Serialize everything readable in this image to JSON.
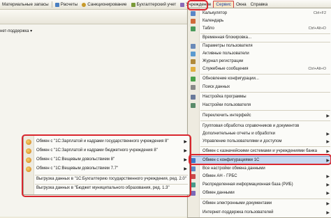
{
  "menubar": {
    "items": [
      {
        "label": "Материальные запасы",
        "icon": "none"
      },
      {
        "label": "Расчеты",
        "icon": "calc-icon"
      },
      {
        "label": "Санкционирование",
        "icon": "sanction-icon"
      },
      {
        "label": "Бухгалтерский учет",
        "icon": "ledger-icon"
      },
      {
        "label": "Учреждение",
        "icon": "institution-icon"
      },
      {
        "label": "Сервис",
        "icon": "none"
      },
      {
        "label": "Окна",
        "icon": "none"
      },
      {
        "label": "Справка",
        "icon": "none"
      }
    ]
  },
  "workarea": {
    "subbar_label": "нет-поддержка ▾"
  },
  "service_menu": {
    "items": [
      {
        "label": "Калькулятор",
        "shortcut": "Ctrl+F2",
        "icon": "calculator-icon"
      },
      {
        "label": "Календарь",
        "shortcut": "",
        "icon": "calendar-icon"
      },
      {
        "label": "Табло",
        "shortcut": "Ctrl+Alt+D",
        "icon": "board-icon"
      },
      {
        "label": "Временная блокировка...",
        "shortcut": "",
        "icon": "lock-icon"
      },
      {
        "label": "Параметры пользователя",
        "shortcut": "",
        "icon": "user-params-icon"
      },
      {
        "label": "Активные пользователи",
        "shortcut": "",
        "icon": "active-users-icon"
      },
      {
        "label": "Журнал регистрации",
        "shortcut": "",
        "icon": "log-icon"
      },
      {
        "label": "Служебные сообщения",
        "shortcut": "Ctrl+Alt+O",
        "icon": "messages-icon"
      },
      {
        "label": "Обновление конфигурации...",
        "shortcut": "",
        "icon": "update-icon"
      },
      {
        "label": "Поиск данных",
        "shortcut": "",
        "icon": "search-icon"
      },
      {
        "label": "Настройка программы",
        "shortcut": "",
        "icon": "program-settings-icon"
      },
      {
        "label": "Настройки пользователя",
        "shortcut": "",
        "icon": "user-settings-icon"
      },
      {
        "label": "Переключить интерфейс",
        "shortcut": "",
        "icon": "none"
      },
      {
        "label": "Групповая обработка справочников и документов",
        "shortcut": "",
        "icon": "none"
      },
      {
        "label": "Дополнительные отчеты и обработки",
        "shortcut": "",
        "icon": "none"
      },
      {
        "label": "Управление пользователями и доступом",
        "shortcut": "",
        "icon": "none"
      },
      {
        "label": "Обмен с казначейскими системами и учреждениями банка",
        "shortcut": "",
        "icon": "none"
      },
      {
        "label": "Обмен с конфигурациями 1С",
        "shortcut": "",
        "icon": "exchange-icon"
      },
      {
        "label": "Все настройки обмена данными",
        "shortcut": "",
        "icon": "exchange-settings-icon"
      },
      {
        "label": "Обмен АН - ГРБС",
        "shortcut": "",
        "icon": "exchange-an-icon"
      },
      {
        "label": "Распределенная информационная база (РИБ)",
        "shortcut": "",
        "icon": "rib-icon"
      },
      {
        "label": "Обмен данными",
        "shortcut": "",
        "icon": "data-exchange-icon"
      },
      {
        "label": "Обмен электронными документами",
        "shortcut": "",
        "icon": "edoc-icon"
      },
      {
        "label": "Интернет-поддержка пользователей",
        "shortcut": "",
        "icon": "support-icon"
      }
    ]
  },
  "exchange_submenu": {
    "items": [
      {
        "label": "Обмен с \"1С:Зарплатой и кадрами государственного учреждения 8\"",
        "icon": "1c-icon"
      },
      {
        "label": "Обмен с \"1С:Зарплатой и кадрами бюджетного учреждения 8\"",
        "icon": "1c-icon"
      },
      {
        "label": "Обмен с \"1С:Вещевым довольствием 8\"",
        "icon": "1c-icon"
      },
      {
        "label": "Обмен с \"1С:Вещевым довольствием 7.7\"",
        "icon": "1c-icon"
      },
      {
        "label": "Выгрузка данных в \"1С:Бухгалтерию государственного учреждения, ред. 2.0\"",
        "icon": "none"
      },
      {
        "label": "Выгрузка данных в \"Бюджет муниципального образования, ред. 1.3\"",
        "icon": "none"
      }
    ]
  },
  "colors": {
    "highlight": "#c8d8f0",
    "annotation": "#d9262e",
    "menubar": "#ece9d8"
  }
}
